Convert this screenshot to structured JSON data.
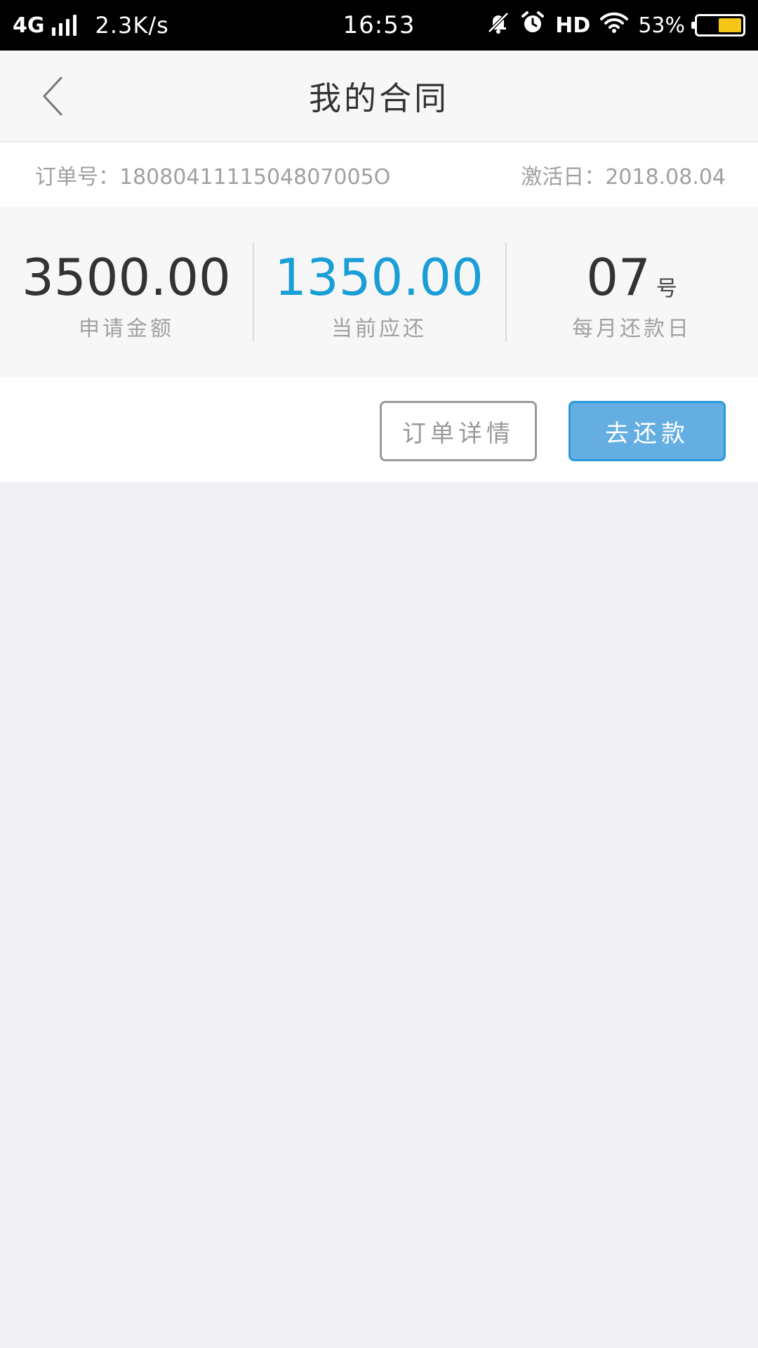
{
  "status_bar": {
    "network": "4G",
    "speed": "2.3K/s",
    "time": "16:53",
    "hd": "HD",
    "battery": "53%",
    "battery_level": 0.53,
    "icons": [
      "signal-icon",
      "mute-bell-icon",
      "alarm-icon",
      "wifi-icon",
      "battery-icon"
    ]
  },
  "nav": {
    "title": "我的合同",
    "back_icon": "chevron-left-icon"
  },
  "order": {
    "number_label": "订单号：",
    "number": "1808041111504807005O",
    "activation_label": "激活日：",
    "activation_date": "2018.08.04"
  },
  "summary": {
    "applied_amount": "3500.00",
    "applied_label": "申请金额",
    "current_due": "1350.00",
    "current_due_label": "当前应还",
    "repay_day": "07",
    "repay_day_suffix": "号",
    "repay_day_label": "每月还款日"
  },
  "actions": {
    "detail_label": "订单详情",
    "repay_label": "去还款"
  },
  "colors": {
    "accent": "#1a9ed6",
    "button_fill": "#64aee2",
    "background": "#efeff4",
    "battery": "#f5c518"
  }
}
